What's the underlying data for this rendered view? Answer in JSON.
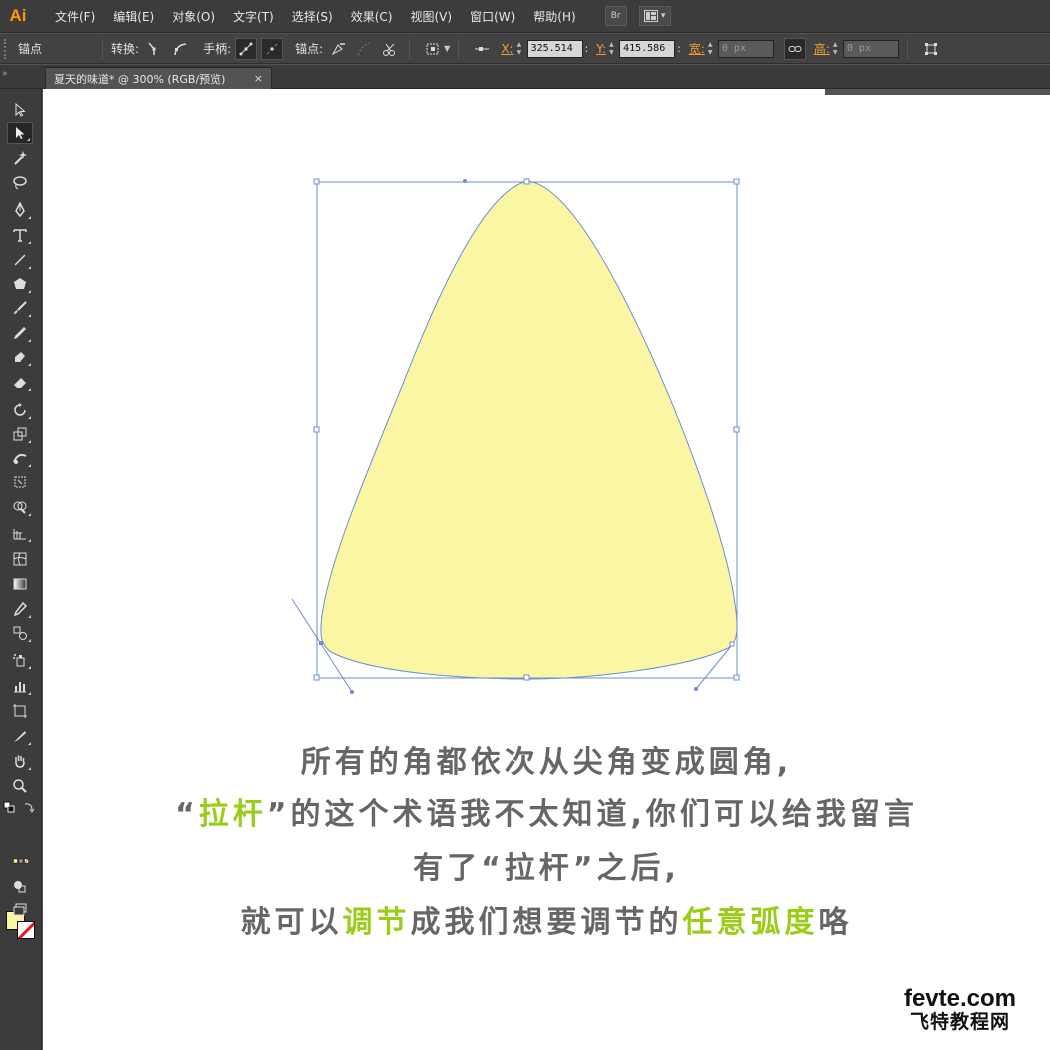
{
  "app": {
    "logo": "Ai"
  },
  "menu": {
    "items": [
      "文件(F)",
      "编辑(E)",
      "对象(O)",
      "文字(T)",
      "选择(S)",
      "效果(C)",
      "视图(V)",
      "窗口(W)",
      "帮助(H)"
    ],
    "bridge_label": "Br",
    "arrange_label": "▾"
  },
  "control": {
    "mode_label": "锚点",
    "convert_label": "转换:",
    "handles_label": "手柄:",
    "anchors_label": "锚点:",
    "x_label": "X:",
    "x_value": "325.514",
    "x_unit": ":",
    "y_label": "Y:",
    "y_value": "415.586",
    "y_unit": ":",
    "w_label": "宽:",
    "w_value": "0 px",
    "h_label": "高:",
    "h_value": "0 px"
  },
  "document": {
    "tab_title": "夏天的味道* @ 300% (RGB/预览)",
    "close_glyph": "×",
    "grip": "»"
  },
  "colors": {
    "fill": "#fbf6a3",
    "stroke": "#e02020",
    "path": "#6b8fd0",
    "highlight": "#9ccc1a",
    "caption": "#666666"
  },
  "caption": {
    "line1": "所有的角都依次从尖角变成圆角,",
    "line2_q_open": "“",
    "line2_hl": "拉杆",
    "line2_q_close": "”",
    "line2_rest": "的这个术语我不太知道,你们可以给我留言",
    "line3": "有了“拉杆”之后,",
    "line4_a": "就可以",
    "line4_hl1": "调节",
    "line4_b": "成我们想要调节的",
    "line4_hl2": "任意弧度",
    "line4_c": "咯"
  },
  "watermark": {
    "top": "fevte.com",
    "bottom": "飞特教程网"
  }
}
